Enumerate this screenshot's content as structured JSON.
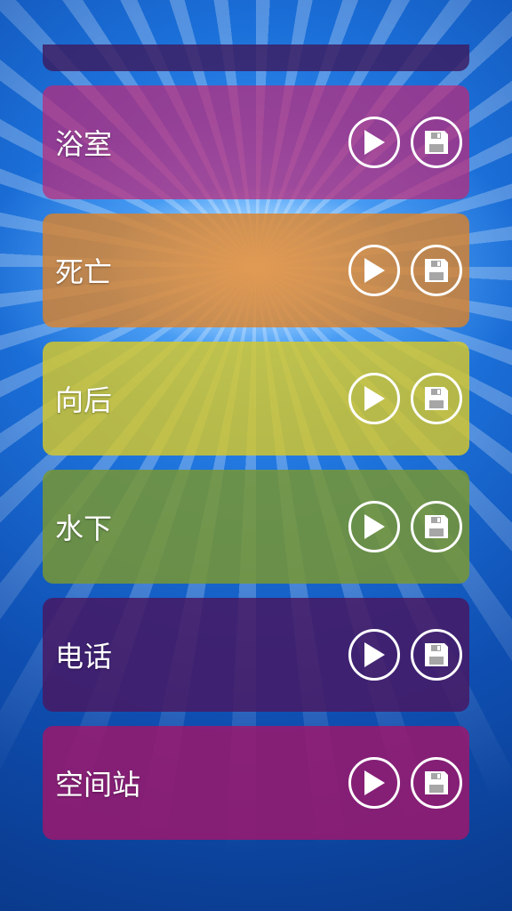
{
  "theme": {
    "background": "#0b3f92",
    "accent": "#ffffff"
  },
  "sounds": [
    {
      "label": "浴室",
      "color": "rgba(190, 40, 120, 0.72)",
      "play_icon": "play-icon",
      "save_icon": "save-icon"
    },
    {
      "label": "死亡",
      "color": "rgba(220, 130, 40, 0.80)",
      "play_icon": "play-icon",
      "save_icon": "save-icon"
    },
    {
      "label": "向后",
      "color": "rgba(215, 200, 40, 0.82)",
      "play_icon": "play-icon",
      "save_icon": "save-icon"
    },
    {
      "label": "水下",
      "color": "rgba(120, 150, 50, 0.85)",
      "play_icon": "play-icon",
      "save_icon": "save-icon"
    },
    {
      "label": "电话",
      "color": "rgba(70, 25, 100, 0.85)",
      "play_icon": "play-icon",
      "save_icon": "save-icon"
    },
    {
      "label": "空间站",
      "color": "rgba(150, 25, 110, 0.88)",
      "play_icon": "play-icon",
      "save_icon": "save-icon"
    }
  ]
}
